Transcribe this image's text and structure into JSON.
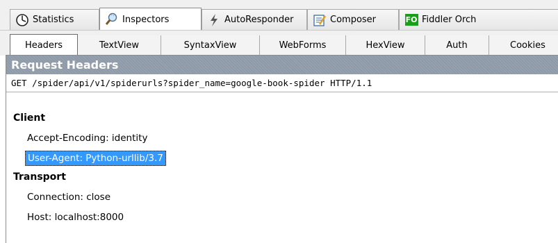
{
  "top_tabs": [
    {
      "label": "Statistics",
      "icon": "statistics-icon"
    },
    {
      "label": "Inspectors",
      "icon": "inspectors-icon"
    },
    {
      "label": "AutoResponder",
      "icon": "autoresponder-icon"
    },
    {
      "label": "Composer",
      "icon": "composer-icon"
    },
    {
      "label": "Fiddler Orch",
      "icon": "fiddler-orchestra-icon",
      "badge": "FO"
    }
  ],
  "sub_tabs": [
    "Headers",
    "TextView",
    "SyntaxView",
    "WebForms",
    "HexView",
    "Auth",
    "Cookies"
  ],
  "request": {
    "section_title": "Request Headers",
    "request_line": "GET /spider/api/v1/spiderurls?spider_name=google-book-spider HTTP/1.1",
    "groups": [
      {
        "name": "Client",
        "items": [
          "Accept-Encoding: identity",
          "User-Agent: Python-urllib/3.7"
        ]
      },
      {
        "name": "Transport",
        "items": [
          "Connection: close",
          "Host: localhost:8000"
        ]
      }
    ],
    "selected_item": "User-Agent: Python-urllib/3.7"
  },
  "colors": {
    "header_bar": "#8e9aa8",
    "selection": "#3399ff",
    "fo_badge": "#17a017"
  }
}
